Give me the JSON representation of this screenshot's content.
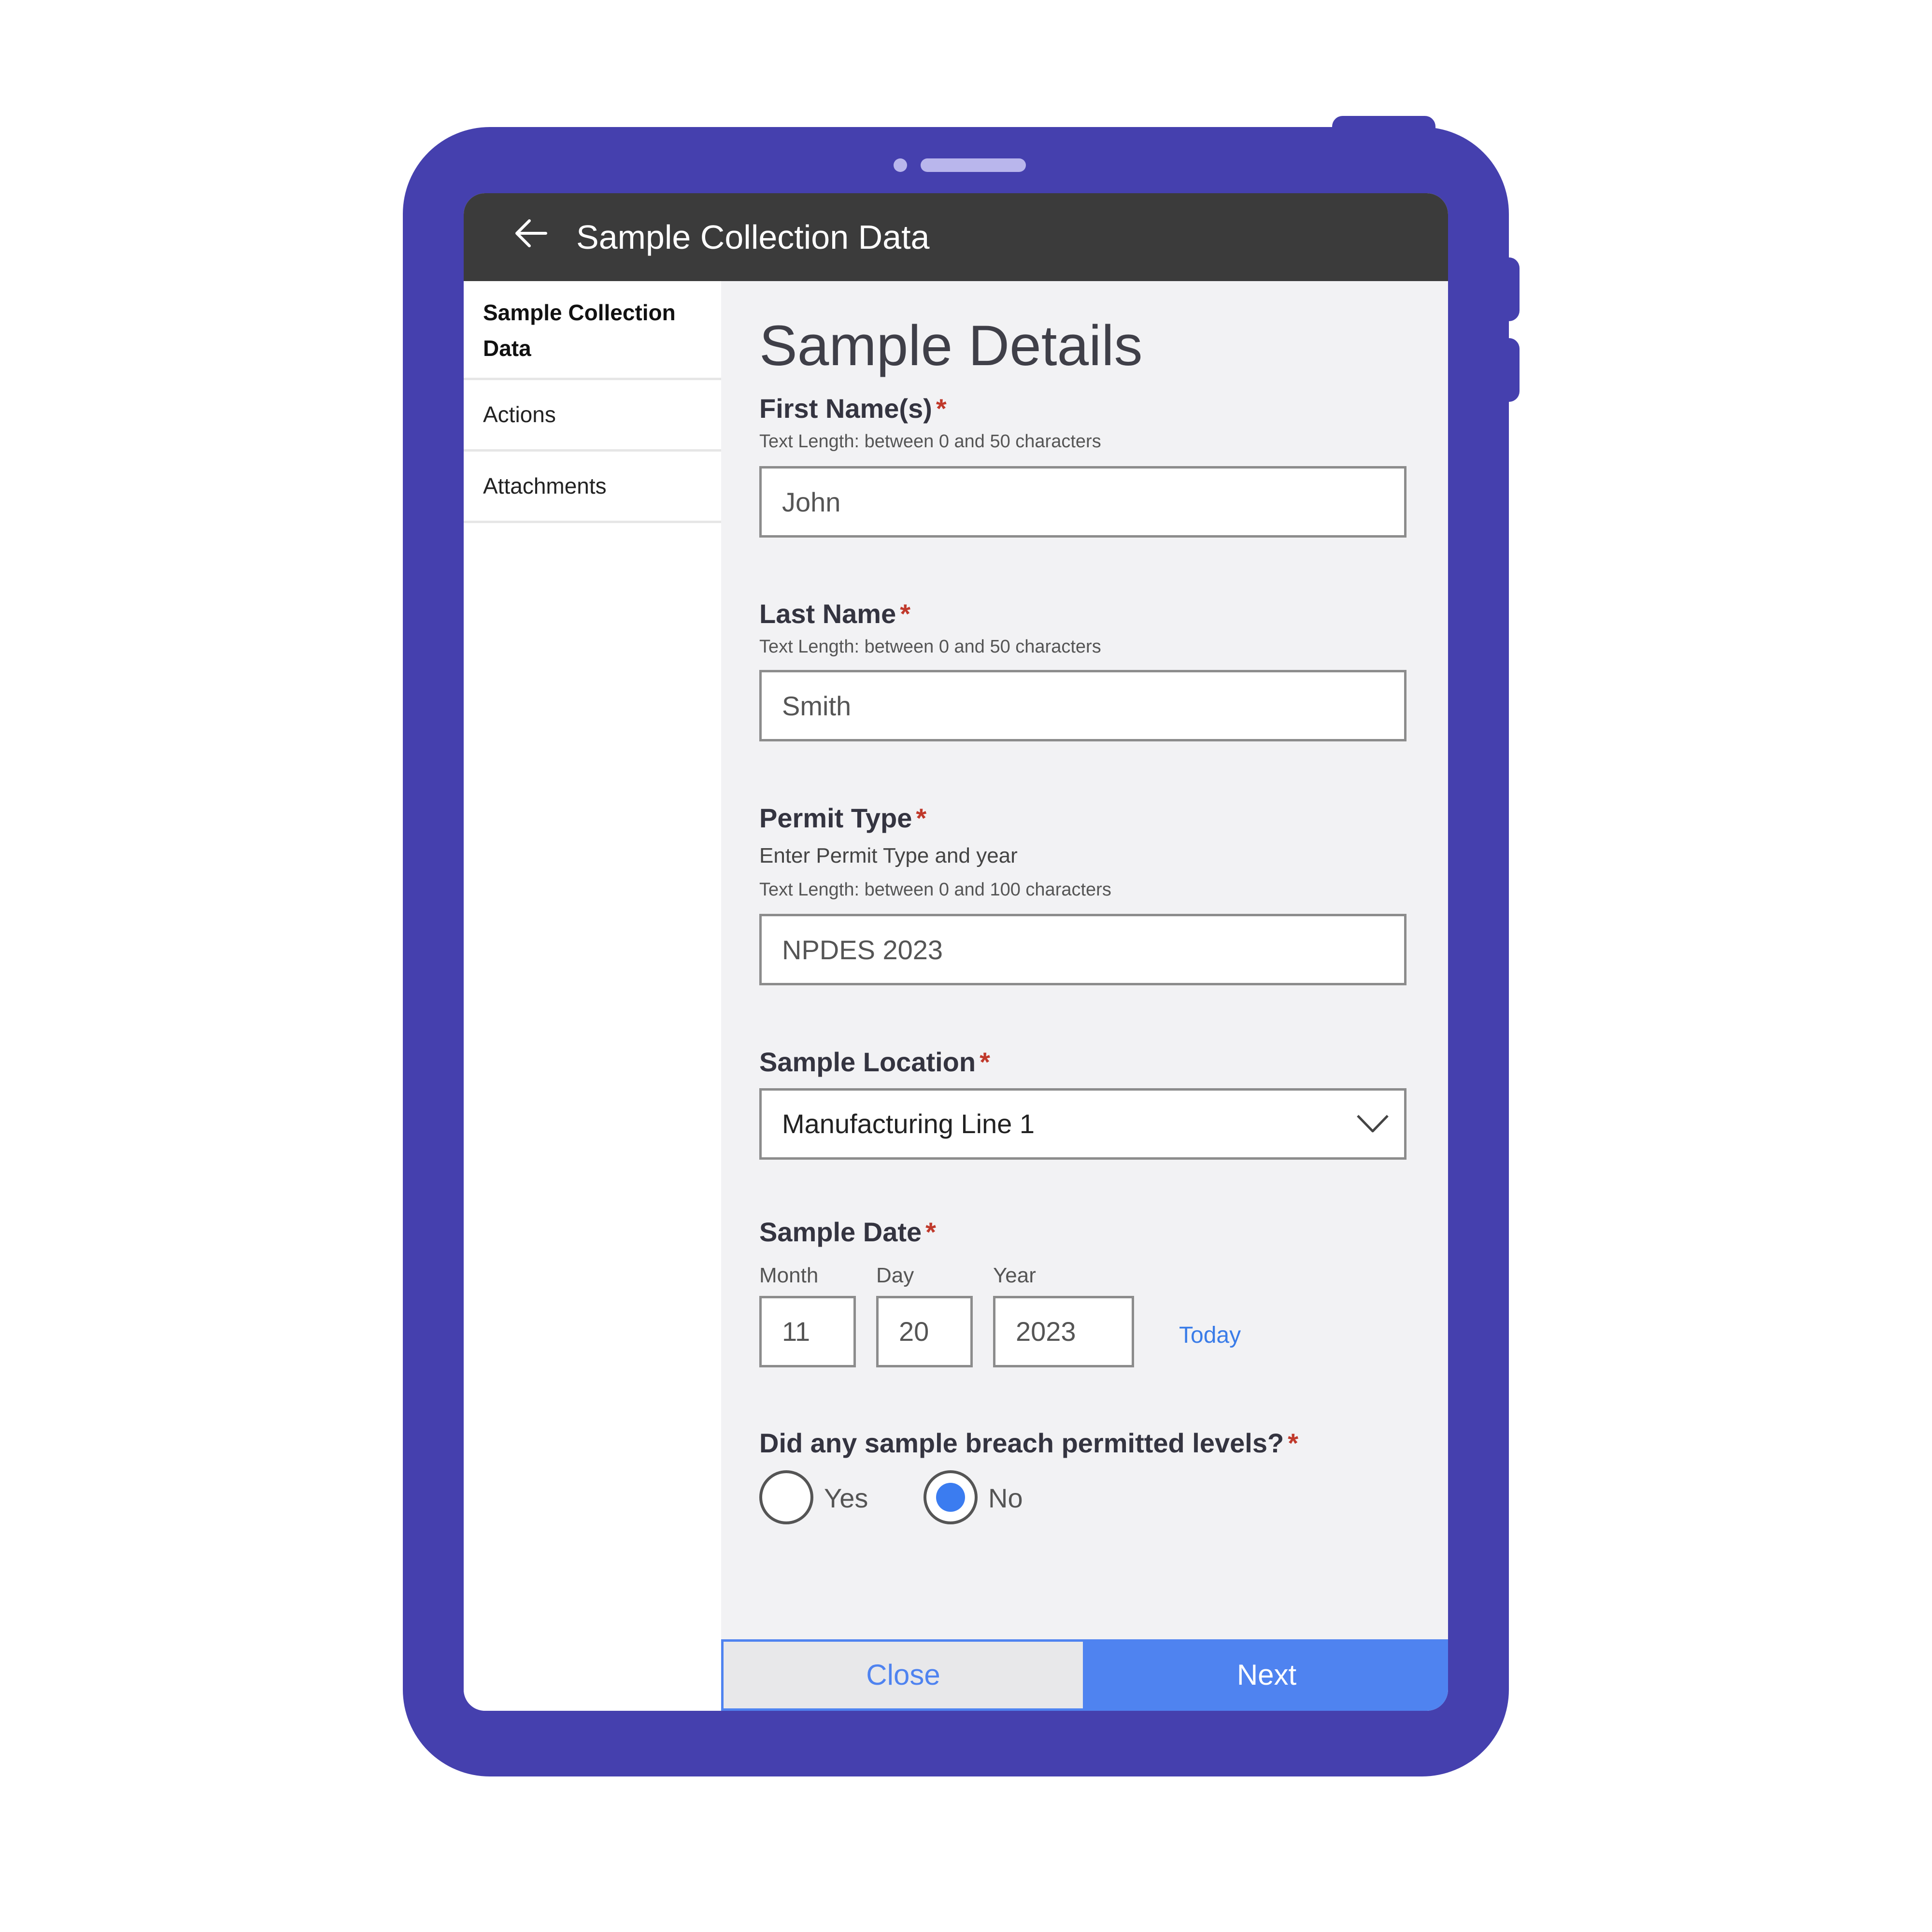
{
  "app": {
    "title": "Sample Collection Data",
    "back_icon": "arrow-left-icon"
  },
  "sidebar": {
    "items": [
      {
        "label": "Sample Collection Data",
        "active": true
      },
      {
        "label": "Actions",
        "active": false
      },
      {
        "label": "Attachments",
        "active": false
      }
    ]
  },
  "form": {
    "heading": "Sample Details",
    "required_marker": "*",
    "first_name": {
      "label": "First Name(s)",
      "hint": "Text Length: between 0 and 50 characters",
      "value": "John"
    },
    "last_name": {
      "label": "Last Name",
      "hint": "Text Length: between 0 and 50 characters",
      "value": "Smith"
    },
    "permit_type": {
      "label": "Permit Type",
      "description": "Enter Permit Type and year",
      "hint": "Text Length: between 0 and 100 characters",
      "value": "NPDES 2023"
    },
    "sample_location": {
      "label": "Sample Location",
      "selected": "Manufacturing Line 1",
      "icon": "chevron-down-icon"
    },
    "sample_date": {
      "label": "Sample Date",
      "month_label": "Month",
      "day_label": "Day",
      "year_label": "Year",
      "month": "11",
      "day": "20",
      "year": "2023",
      "today_label": "Today"
    },
    "breach": {
      "label": "Did any sample breach permitted levels?",
      "options": [
        "Yes",
        "No"
      ],
      "selected": "No"
    }
  },
  "footer": {
    "close_label": "Close",
    "next_label": "Next"
  },
  "colors": {
    "device_frame": "#4540ae",
    "header_bg": "#3b3b3b",
    "accent": "#4f83f0",
    "required": "#c0392b"
  }
}
